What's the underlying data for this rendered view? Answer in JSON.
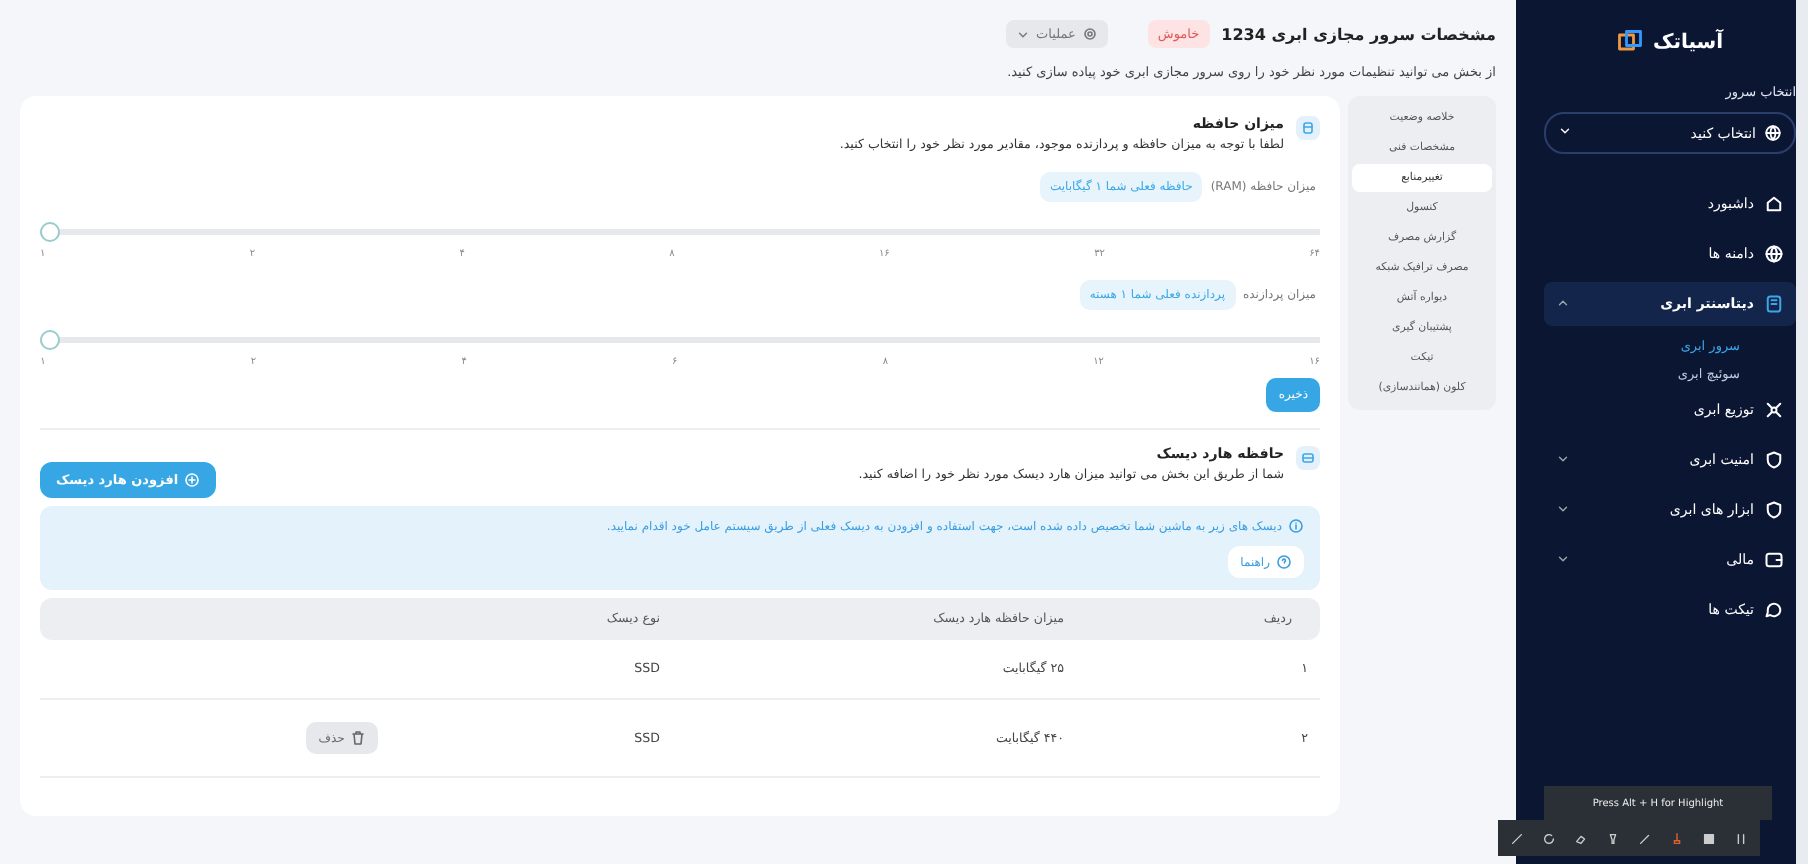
{
  "header": {
    "title": "مشخصات سرور مجازی ابری 1234",
    "status": "خاموش",
    "actions": "عملیات",
    "subtitle": "از بخش می توانید تنظیمات مورد نظر خود را روی سرور مجازی ابری خود پیاده سازی کنید."
  },
  "tabs": [
    {
      "label": "خلاصه وضعیت",
      "selected": false
    },
    {
      "label": "مشخصات فنی",
      "selected": false
    },
    {
      "label": "تغییرمنابع",
      "selected": true
    },
    {
      "label": "کنسول",
      "selected": false
    },
    {
      "label": "گزارش مصرف",
      "selected": false
    },
    {
      "label": "مصرف ترافیک شبکه",
      "selected": false
    },
    {
      "label": "دیواره آتش",
      "selected": false
    },
    {
      "label": "پشتیبان گیری",
      "selected": false
    },
    {
      "label": "تیکت",
      "selected": false
    },
    {
      "label": "کلون (همانندسازی)",
      "selected": false
    }
  ],
  "memory": {
    "title": "میزان حافظه",
    "description": "لطفا با توجه به میزان حافظه و پردازنده موجود، مقادیر مورد نظر خود را انتخاب کنید.",
    "sliders": [
      {
        "label": "میزان حافظه (RAM)",
        "current": "حافظه فعلی شما ۱ گیگابایت",
        "level": 0,
        "ticks": [
          "۶۴",
          "۳۲",
          "۱۶",
          "۸",
          "۴",
          "۲",
          "۱"
        ]
      },
      {
        "label": "میزان پردازنده",
        "current": "پردازنده فعلی شما ۱ هسته",
        "level": 0,
        "ticks": [
          "۱۶",
          "۱۲",
          "۸",
          "۶",
          "۴",
          "۲",
          "۱"
        ]
      }
    ],
    "save": "ذخیره"
  },
  "disk": {
    "title": "حافظه هارد دیسک",
    "description": "شما از طریق این بخش می توانید میزان هارد دیسک مورد نظر خود را اضافه کنید.",
    "add": "افزودن هارد دیسک",
    "alert": "دیسک های زیر به ماشین شما تخصیص داده شده است، جهت استفاده و افزودن به دیسک فعلی از طریق سیستم عامل خود اقدام نمایید.",
    "guide": "راهنما",
    "table": {
      "columns": [
        "ردیف",
        "میزان حافظه هارد دیسک",
        "نوع دیسک"
      ],
      "rows": [
        {
          "cells": [
            "۱",
            "۲۵ گیگابایت",
            "SSD"
          ]
        },
        {
          "cells": [
            "۲",
            "۴۴۰ گیگابایت",
            "SSD"
          ],
          "action": "حذف"
        }
      ]
    }
  },
  "sidebar": {
    "logo": "آسیاتک",
    "server_label": "انتخاب سرور",
    "server_select": {
      "placeholder": "انتخاب کنید"
    },
    "items": [
      {
        "label": "داشبورد",
        "selected": false
      },
      {
        "label": "دامنه ها",
        "selected": false
      },
      {
        "label": "دیتاسنتر ابری",
        "selected": true,
        "expanded": true,
        "children": [
          {
            "label": "سرور ابری",
            "selected": true
          },
          {
            "label": "سوئیچ ابری",
            "selected": false
          }
        ]
      },
      {
        "label": "توزیع ابری",
        "selected": false
      },
      {
        "label": "امنیت ابری",
        "selected": false,
        "expanded": false
      },
      {
        "label": "ابزار های ابری",
        "selected": false,
        "expanded": false
      },
      {
        "label": "مالی",
        "selected": false,
        "expanded": false
      },
      {
        "label": "تیکت ها",
        "selected": false
      }
    ]
  },
  "recorder": {
    "hint": "Press Alt + H for Highlight"
  }
}
